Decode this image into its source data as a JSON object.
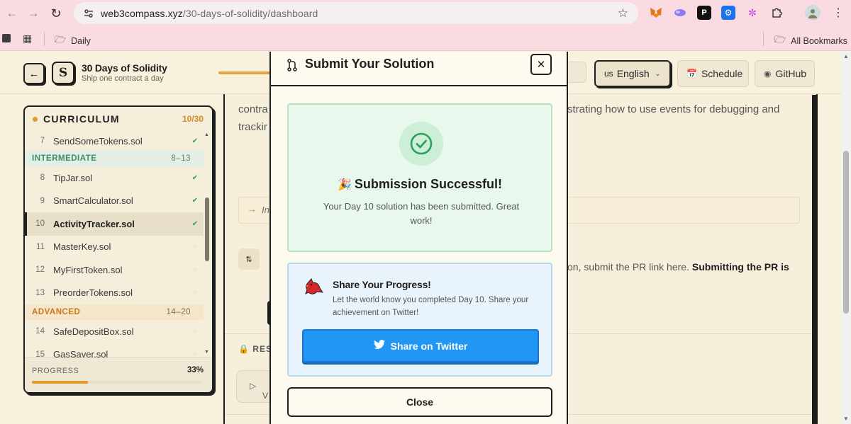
{
  "browser": {
    "url_domain": "web3compass.xyz",
    "url_path": "/30-days-of-solidity/dashboard",
    "bookmarks": {
      "daily": "Daily",
      "all": "All Bookmarks"
    }
  },
  "header": {
    "brand_title": "30 Days of Solidity",
    "brand_subtitle": "Ship one contract a day",
    "language_flag": "us",
    "language": "English",
    "schedule": "Schedule",
    "github": "GitHub"
  },
  "sidebar": {
    "title": "CURRICULUM",
    "count": "10/30",
    "rows_top": [
      {
        "num": "7",
        "name": "SendSomeTokens.sol",
        "done": true
      }
    ],
    "intermediate": {
      "label": "INTERMEDIATE",
      "range": "8–13"
    },
    "rows_mid": [
      {
        "num": "8",
        "name": "TipJar.sol",
        "done": true
      },
      {
        "num": "9",
        "name": "SmartCalculator.sol",
        "done": true
      },
      {
        "num": "10",
        "name": "ActivityTracker.sol",
        "done": true
      },
      {
        "num": "11",
        "name": "MasterKey.sol",
        "done": false
      },
      {
        "num": "12",
        "name": "MyFirstToken.sol",
        "done": false
      },
      {
        "num": "13",
        "name": "PreorderTokens.sol",
        "done": false
      }
    ],
    "advanced": {
      "label": "ADVANCED",
      "range": "14–20"
    },
    "rows_adv": [
      {
        "num": "14",
        "name": "SafeDepositBox.sol",
        "done": false
      },
      {
        "num": "15",
        "name": "GasSaver.sol",
        "done": false
      }
    ],
    "progress_label": "PROGRESS",
    "progress_pct": "33%",
    "progress_value": 0.33
  },
  "background": {
    "line1_left": "contra",
    "line1_right": "strating how to use events for debugging and",
    "line2_left": "trackir",
    "note_text": "In",
    "pr_text_plain": "on, submit the PR link here. ",
    "pr_text_bold": "Submitting the PR is",
    "resources_label": "RES",
    "video_label": "V"
  },
  "modal": {
    "title": "Submit Your Solution",
    "success_title": "Submission Successful!",
    "success_message": "Your Day 10 solution has been submitted. Great work!",
    "share_title": "Share Your Progress!",
    "share_message": "Let the world know you completed Day 10. Share your achievement on Twitter!",
    "twitter_button": "Share on Twitter",
    "close_button": "Close"
  },
  "colors": {
    "accent_orange": "#e39a2d",
    "success_green": "#2aa05a",
    "twitter_blue": "#2196f3",
    "chrome_pink": "#fbdbe2"
  }
}
